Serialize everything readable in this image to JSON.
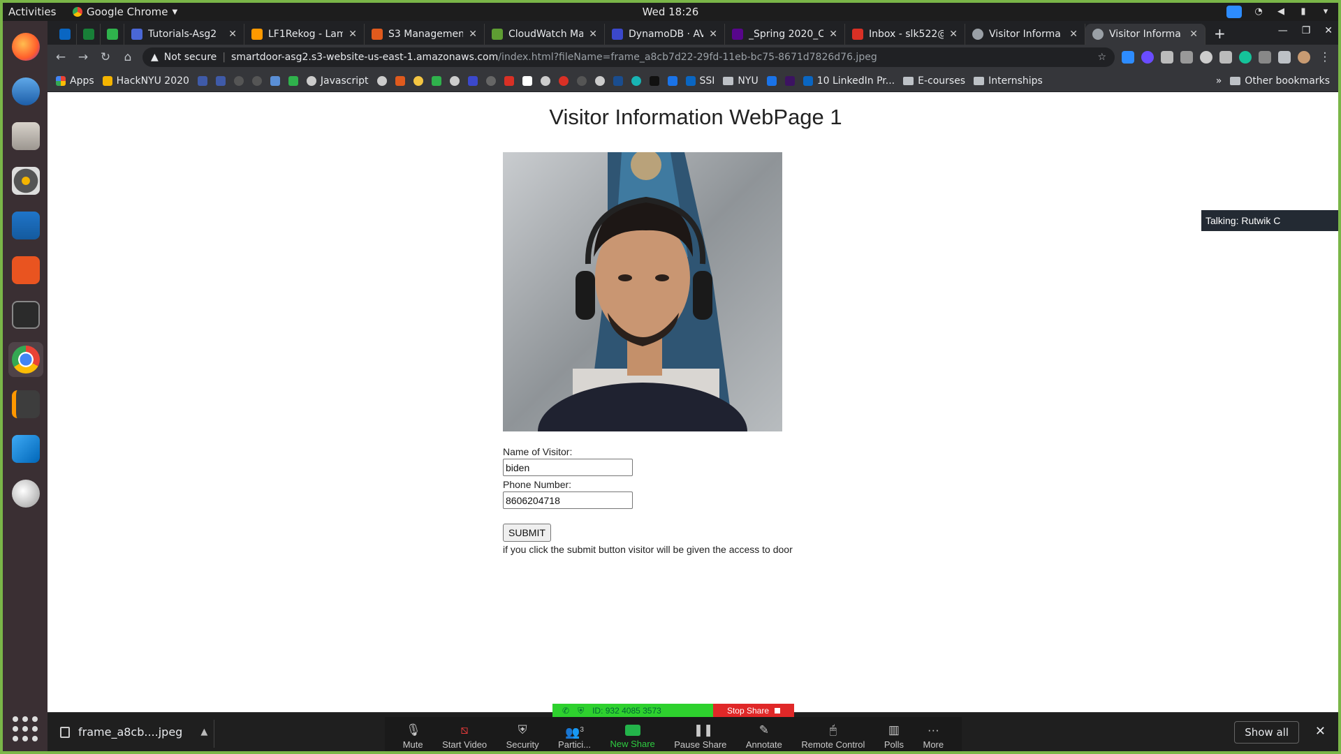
{
  "os": {
    "activities": "Activities",
    "app_name": "Google Chrome",
    "clock": "Wed 18:26"
  },
  "tabs": [
    {
      "title": "",
      "color": "#0a66c2"
    },
    {
      "title": "",
      "color": "#188038"
    },
    {
      "title": "",
      "color": "#2fb24c"
    },
    {
      "title": "Tutorials-Asg2",
      "color": "#4a67d6"
    },
    {
      "title": "LF1Rekog - Lam",
      "color": "#ff9900"
    },
    {
      "title": "S3 Managemen",
      "color": "#e05a1d"
    },
    {
      "title": "CloudWatch Ma",
      "color": "#5e9d33"
    },
    {
      "title": "DynamoDB · AV",
      "color": "#3b48cc"
    },
    {
      "title": "_Spring 2020_C",
      "color": "#57068c"
    },
    {
      "title": "Inbox - slk522@",
      "color": "#d93025"
    },
    {
      "title": "Visitor Informa",
      "color": "#9aa0a6"
    },
    {
      "title": "Visitor Informa",
      "color": "#9aa0a6"
    }
  ],
  "address": {
    "security": "Not secure",
    "host": "smartdoor-asg2.s3-website-us-east-1.amazonaws.com",
    "path": "/index.html?fileName=frame_a8cb7d22-29fd-11eb-bc75-8671d7826d76.jpeg"
  },
  "bookmarks": {
    "apps": "Apps",
    "items": [
      "HackNYU 2020",
      "Javascript",
      "SSI",
      "NYU",
      "10 LinkedIn Pr...",
      "E-courses",
      "Internships"
    ],
    "more": "»",
    "other": "Other bookmarks"
  },
  "page": {
    "title": "Visitor Information WebPage 1",
    "name_label": "Name of Visitor:",
    "name_value": "biden",
    "phone_label": "Phone Number:",
    "phone_value": "8606204718",
    "submit_label": "SUBMIT",
    "note": "if you click the submit button visitor will be given the access to door"
  },
  "zoom": {
    "talking": "Talking: Rutwik C",
    "meeting_id": "ID: 932 4085 3573",
    "stop_share": "Stop Share",
    "controls": {
      "mute": "Mute",
      "start_video": "Start Video",
      "security": "Security",
      "participants": "Partici...",
      "participants_count": "3",
      "new_share": "New Share",
      "pause_share": "Pause Share",
      "annotate": "Annotate",
      "remote_control": "Remote Control",
      "polls": "Polls",
      "more": "More"
    }
  },
  "downloads": {
    "file": "frame_a8cb....jpeg",
    "show_all": "Show all"
  }
}
